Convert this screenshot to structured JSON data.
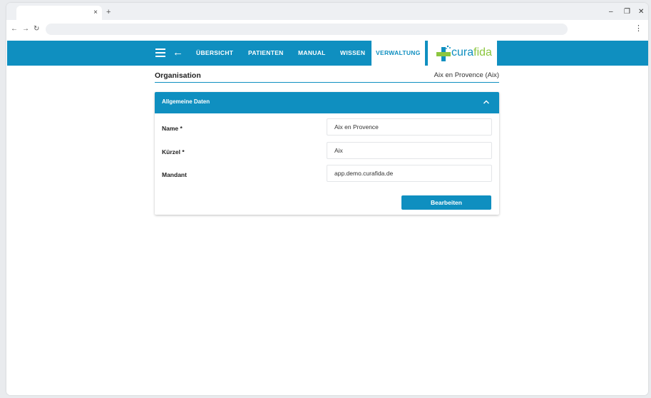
{
  "browser": {
    "tab_close": "×",
    "new_tab": "+",
    "minimize": "–",
    "restore": "❐",
    "close": "✕",
    "back": "←",
    "forward": "→",
    "reload": "↻",
    "address": "",
    "menu": "⋮"
  },
  "appbar": {
    "back_arrow": "←",
    "nav": [
      {
        "label": "ÜBERSICHT"
      },
      {
        "label": "PATIENTEN"
      },
      {
        "label": "MANUAL"
      },
      {
        "label": "WISSEN"
      },
      {
        "label": "VERWALTUNG"
      }
    ],
    "logo": {
      "part1": "cura",
      "part2": "fida"
    },
    "colors": {
      "primary": "#0f8fc0",
      "logo_green": "#8cc63f"
    }
  },
  "organisation": {
    "title": "Organisation",
    "name": "Aix en Provence (Aix)"
  },
  "card": {
    "title": "Allgemeine Daten",
    "fields": [
      {
        "label": "Name *",
        "value": "Aix en Provence"
      },
      {
        "label": "Kürzel *",
        "value": "Aix"
      },
      {
        "label": "Mandant",
        "value": "app.demo.curafida.de"
      }
    ],
    "edit_button": "Bearbeiten"
  }
}
